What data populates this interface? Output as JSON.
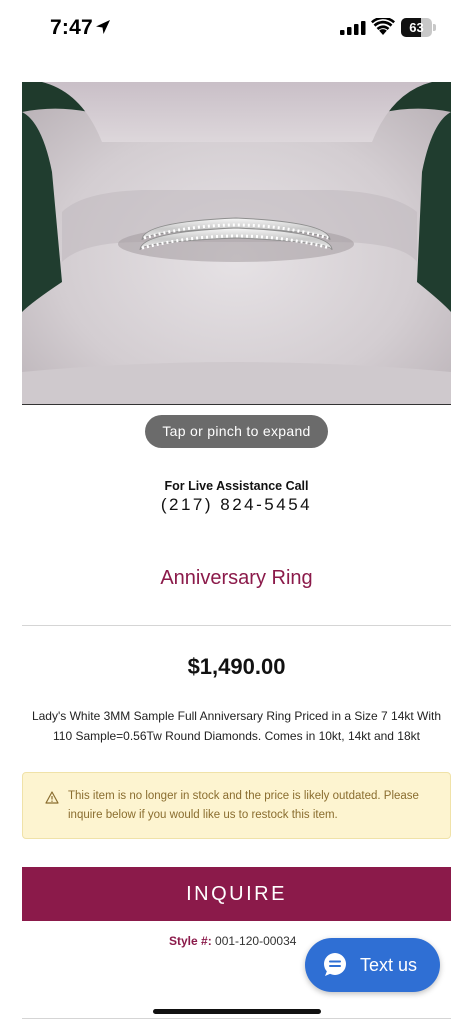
{
  "status_bar": {
    "time": "7:47",
    "battery_percent": 63,
    "battery_label": "63",
    "icons": [
      "location-arrow-icon",
      "cellular-signal-icon",
      "wifi-icon",
      "battery-icon"
    ]
  },
  "product_image": {
    "icon": "ring-photo"
  },
  "image_hint": "Tap or pinch to expand",
  "assistance": {
    "label": "For Live Assistance Call",
    "phone": "(217) 824-5454"
  },
  "product": {
    "title": "Anniversary Ring",
    "price": "$1,490.00",
    "description": "Lady's White 3MM Sample Full Anniversary Ring Priced in a Size 7 14kt With 110 Sample=0.56Tw Round Diamonds. Comes in 10kt, 14kt and 18kt",
    "style_label": "Style #:",
    "style_number": "001-120-00034"
  },
  "warning": {
    "icon": "warning-triangle-icon",
    "text": "This item is no longer in stock and the price is likely outdated. Please inquire below if you would like us to restock this item."
  },
  "inquire_button": {
    "label": "INQUIRE"
  },
  "chat_widget": {
    "icon": "chat-bubble-icon",
    "label": "Text us"
  },
  "colors": {
    "brand": "#8b1a4a",
    "warning_bg": "#fdf4d0",
    "warning_text": "#8a6d2f",
    "chat_button": "#2f6fd4"
  }
}
